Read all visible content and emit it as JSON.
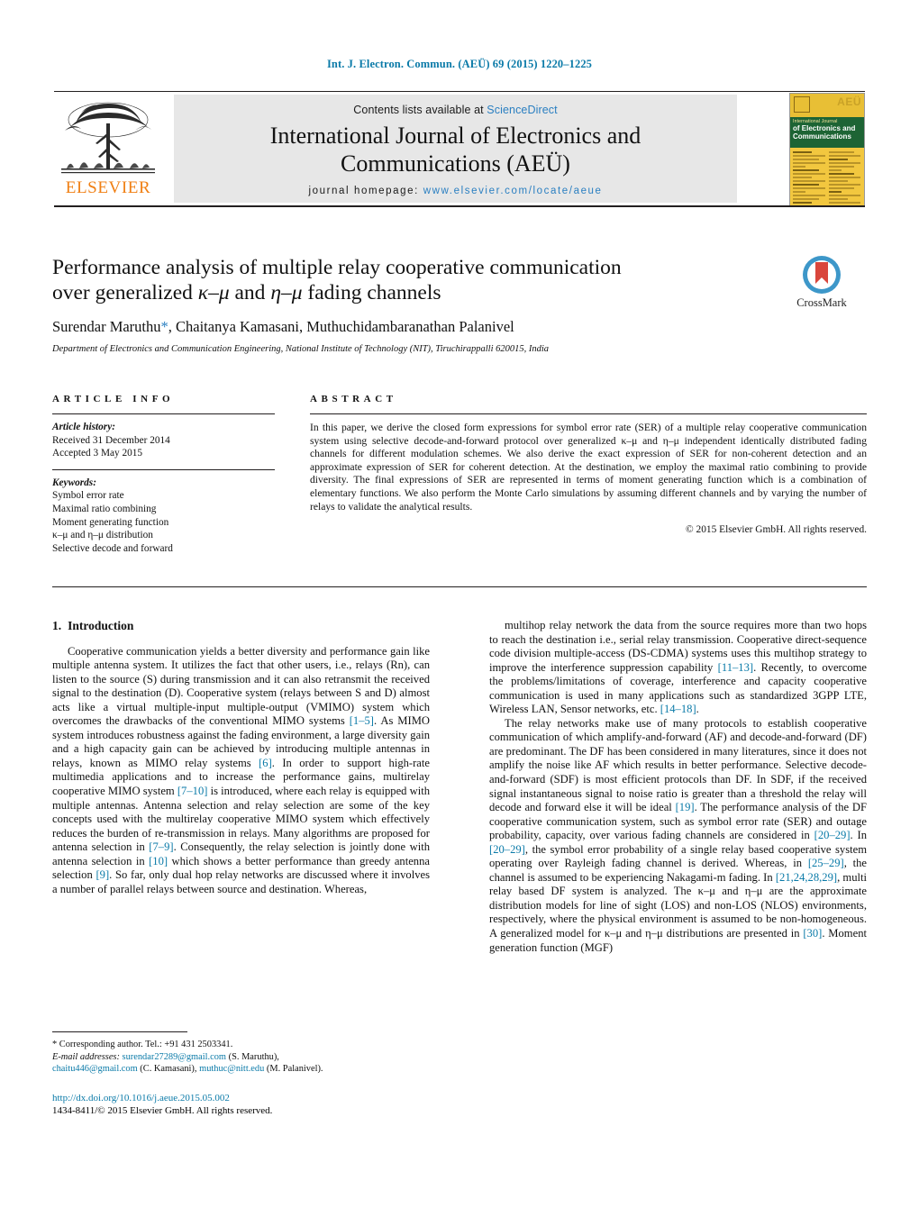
{
  "running_head": "Int. J. Electron. Commun. (AEÜ) 69 (2015) 1220–1225",
  "masthead": {
    "contents_prefix": "Contents lists available at ",
    "sciencedirect": "ScienceDirect",
    "journal_title_line1": "International Journal of Electronics and",
    "journal_title_line2": "Communications (AEÜ)",
    "homepage_prefix": "journal homepage: ",
    "homepage_url": "www.elsevier.com/locate/aeue",
    "publisher": "ELSEVIER",
    "cover": {
      "band_line1": "International Journal",
      "band_line2": "of Electronics and",
      "band_line3": "Communications",
      "corner_label": "AEÜ"
    }
  },
  "article": {
    "title_line1": "Performance analysis of multiple relay cooperative communication",
    "title_line2_pre": "over generalized ",
    "title_line2_k": "κ–μ",
    "title_line2_mid": " and ",
    "title_line2_e": "η–μ",
    "title_line2_post": " fading channels",
    "authors": "Surendar Maruthu, Chaitanya Kamasani, Muthuchidambaranathan Palanivel",
    "corresponding_marker": "*",
    "affiliation": "Department of Electronics and Communication Engineering, National Institute of Technology (NIT), Tiruchirappalli 620015, India",
    "crossmark_label": "CrossMark"
  },
  "article_info": {
    "heading": "ARTICLE INFO",
    "history_label": "Article history:",
    "received": "Received 31 December 2014",
    "accepted": "Accepted 3 May 2015",
    "keywords_label": "Keywords:",
    "keywords": [
      "Symbol error rate",
      "Maximal ratio combining",
      "Moment generating function",
      "κ–μ and η–μ distribution",
      "Selective decode and forward"
    ]
  },
  "abstract": {
    "heading": "ABSTRACT",
    "text": "In this paper, we derive the closed form expressions for symbol error rate (SER) of a multiple relay cooperative communication system using selective decode-and-forward protocol over generalized κ–μ and η–μ independent identically distributed fading channels for different modulation schemes. We also derive the exact expression of SER for non-coherent detection and an approximate expression of SER for coherent detection. At the destination, we employ the maximal ratio combining to provide diversity. The final expressions of SER are represented in terms of moment generating function which is a combination of elementary functions. We also perform the Monte Carlo simulations by assuming different channels and by varying the number of relays to validate the analytical results.",
    "copyright": "© 2015 Elsevier GmbH. All rights reserved."
  },
  "introduction": {
    "number": "1.",
    "title": "Introduction",
    "left_paragraph_1": "Cooperative communication yields a better diversity and performance gain like multiple antenna system. It utilizes the fact that other users, i.e., relays (Rn), can listen to the source (S) during transmission and it can also retransmit the received signal to the destination (D). Cooperative system (relays between S and D) almost acts like a virtual multiple-input multiple-output (VMIMO) system which overcomes the drawbacks of the conventional MIMO systems [1–5]. As MIMO system introduces robustness against the fading environment, a large diversity gain and a high capacity gain can be achieved by introducing multiple antennas in relays, known as MIMO relay systems [6]. In order to support high-rate multimedia applications and to increase the performance gains, multirelay cooperative MIMO system [7–10] is introduced, where each relay is equipped with multiple antennas. Antenna selection and relay selection are some of the key concepts used with the multirelay cooperative MIMO system which effectively reduces the burden of re-transmission in relays. Many algorithms are proposed for antenna selection in [7–9]. Consequently, the relay selection is jointly done with antenna selection in [10] which shows a better performance than greedy antenna selection [9]. So far, only dual hop relay networks are discussed where it involves a number of parallel relays between source and destination. Whereas,",
    "right_paragraph_1": "multihop relay network the data from the source requires more than two hops to reach the destination i.e., serial relay transmission. Cooperative direct-sequence code division multiple-access (DS-CDMA) systems uses this multihop strategy to improve the interference suppression capability [11–13]. Recently, to overcome the problems/limitations of coverage, interference and capacity cooperative communication is used in many applications such as standardized 3GPP LTE, Wireless LAN, Sensor networks, etc. [14–18].",
    "right_paragraph_2": "The relay networks make use of many protocols to establish cooperative communication of which amplify-and-forward (AF) and decode-and-forward (DF) are predominant. The DF has been considered in many literatures, since it does not amplify the noise like AF which results in better performance. Selective decode-and-forward (SDF) is most efficient protocols than DF. In SDF, if the received signal instantaneous signal to noise ratio is greater than a threshold the relay will decode and forward else it will be ideal [19]. The performance analysis of the DF cooperative communication system, such as symbol error rate (SER) and outage probability, capacity, over various fading channels are considered in [20–29]. In [20–29], the symbol error probability of a single relay based cooperative system operating over Rayleigh fading channel is derived. Whereas, in [25–29], the channel is assumed to be experiencing Nakagami-m fading. In [21,24,28,29], multi relay based DF system is analyzed. The κ–μ and η–μ are the approximate distribution models for line of sight (LOS) and non-LOS (NLOS) environments, respectively, where the physical environment is assumed to be non-homogeneous. A generalized model for κ–μ and η–μ distributions are presented in [30]. Moment generation function (MGF)"
  },
  "footnote": {
    "corresponding": "* Corresponding author. Tel.: +91 431 2503341.",
    "email_label": "E-mail addresses:",
    "email_1": "surendar27289@gmail.com",
    "email_1_who": " (S. Maruthu),",
    "email_2": "chaitu446@gmail.com",
    "email_2_who": " (C. Kamasani),",
    "email_3": "muthuc@nitt.edu",
    "email_3_who": " (M. Palanivel).",
    "doi": "http://dx.doi.org/10.1016/j.aeue.2015.05.002",
    "issn_line": "1434-8411/© 2015 Elsevier GmbH. All rights reserved."
  },
  "colors": {
    "link": "#0a7aa8",
    "sciencedirect": "#2a7fc1",
    "elsevier_orange": "#F07F13",
    "masthead_bg": "#e7e7e7",
    "cover_yellow": "#f2c73f",
    "cover_green": "#1d6434",
    "crossmark_blue": "#3d97c9",
    "crossmark_red": "#d9463c"
  }
}
